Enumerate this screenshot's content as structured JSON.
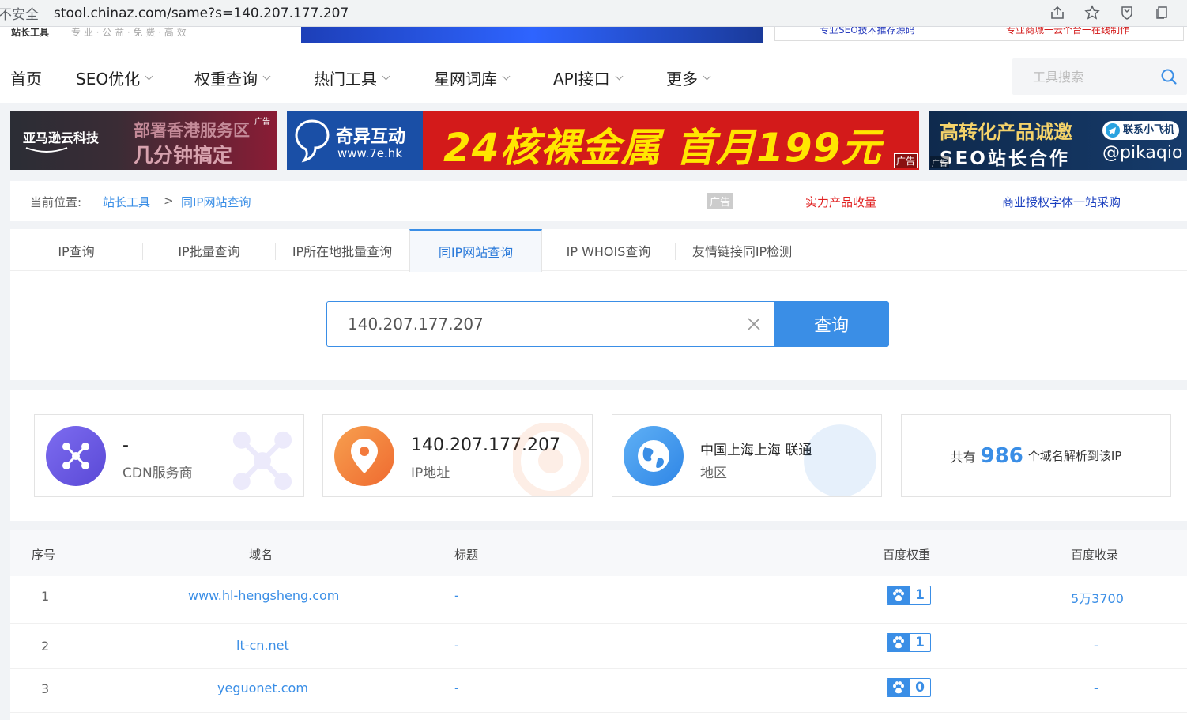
{
  "browser": {
    "insecure_label": "不安全",
    "url": "stool.chinaz.com/same?s=140.207.177.207"
  },
  "top_strip": {
    "logo": "站长工具",
    "slogan": "专 业 · 公 益 · 免 费 · 高 效",
    "right_ad_1": "专业SEO技术推荐源码",
    "right_ad_2": "专业商城一云个台一在线制作"
  },
  "nav": {
    "items": [
      {
        "label": "首页",
        "dropdown": false
      },
      {
        "label": "SEO优化",
        "dropdown": true
      },
      {
        "label": "权重查询",
        "dropdown": true
      },
      {
        "label": "热门工具",
        "dropdown": true
      },
      {
        "label": "星网词库",
        "dropdown": true
      },
      {
        "label": "API接口",
        "dropdown": true
      },
      {
        "label": "更多",
        "dropdown": true
      }
    ],
    "search_placeholder": "工具搜索"
  },
  "ads": {
    "ad1": {
      "brand": "亚马逊云科技",
      "line1": "部署香港服务区",
      "line2": "几分钟搞定",
      "tag": "广告"
    },
    "ad2": {
      "brand": "奇异互动",
      "site": "www.7e.hk",
      "headline": "24核裸金属 首月199元",
      "tag": "广告"
    },
    "ad3": {
      "line1": "高转化产品诚邀",
      "line2": "SEO站长合作",
      "contact_label": "联系小飞机",
      "handle": "@pikaqio",
      "tag": "广告"
    }
  },
  "breadcrumb": {
    "prefix": "当前位置:",
    "level1": "站长工具",
    "separator": ">",
    "level2": "同IP网站查询",
    "ad_tag": "广告",
    "ad_link_1": "实力产品收量",
    "ad_link_2": "商业授权字体一站采购"
  },
  "tabs": [
    {
      "label": "IP查询",
      "active": false
    },
    {
      "label": "IP批量查询",
      "active": false
    },
    {
      "label": "IP所在地批量查询",
      "active": false
    },
    {
      "label": "同IP网站查询",
      "active": true
    },
    {
      "label": "IP WHOIS查询",
      "active": false
    },
    {
      "label": "友情链接同IP检测",
      "active": false
    }
  ],
  "query": {
    "value": "140.207.177.207",
    "button": "查询"
  },
  "stats": {
    "cdn": {
      "value": "-",
      "label": "CDN服务商"
    },
    "ip": {
      "value": "140.207.177.207",
      "label": "IP地址"
    },
    "region": {
      "value": "中国上海上海 联通",
      "label": "地区"
    },
    "total": {
      "prefix": "共有",
      "count": "986",
      "suffix": "个域名解析到该IP"
    }
  },
  "colors": {
    "accent": "#3a8ee6",
    "ad_red": "#d31a1a",
    "cdn_purple": "#6a5ae0",
    "ip_orange": "#f37a3c",
    "region_blue": "#3a8ee6"
  },
  "table": {
    "headers": [
      "序号",
      "域名",
      "标题",
      "百度权重",
      "百度收录"
    ],
    "rows": [
      {
        "index": "1",
        "domain": "www.hl-hengsheng.com",
        "title": "-",
        "weight": "1",
        "indexed": "5万3700"
      },
      {
        "index": "2",
        "domain": "lt-cn.net",
        "title": "-",
        "weight": "1",
        "indexed": "-"
      },
      {
        "index": "3",
        "domain": "yeguonet.com",
        "title": "-",
        "weight": "0",
        "indexed": "-"
      }
    ]
  }
}
